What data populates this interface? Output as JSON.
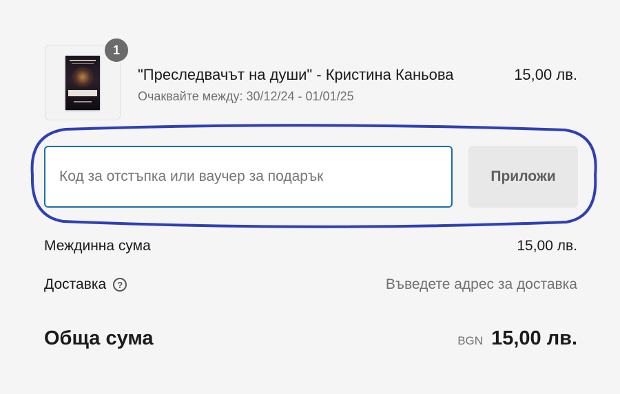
{
  "cart": {
    "item": {
      "quantity": "1",
      "name": "\"Преследвачът на души\" - Кристина Каньова",
      "delivery_estimate": "Очаквайте между: 30/12/24 - 01/01/25",
      "price": "15,00 лв."
    }
  },
  "discount": {
    "placeholder": "Код за отстъпка или ваучер за подарък",
    "value": "",
    "apply_label": "Приложи"
  },
  "summary": {
    "subtotal_label": "Междинна сума",
    "subtotal_value": "15,00 лв.",
    "shipping_label": "Доставка",
    "shipping_help_icon": "question-circle-icon",
    "shipping_value": "Въведете адрес за доставка",
    "total_label": "Обща сума",
    "currency_code": "BGN",
    "total_value": "15,00 лв."
  },
  "colors": {
    "input_border": "#1b6fa8",
    "highlight_ellipse": "#2f3fb5",
    "badge": "#6b6b6b",
    "muted_text": "#707070"
  }
}
